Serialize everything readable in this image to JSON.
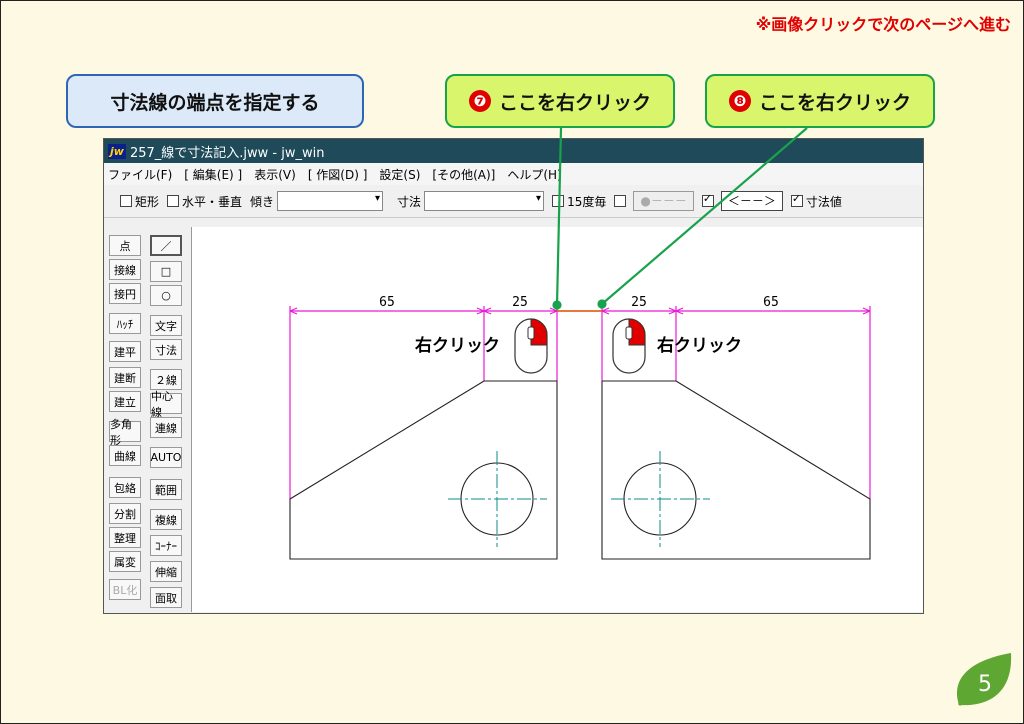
{
  "notice": "※画像クリックで次のページへ進む",
  "callouts": {
    "main": "寸法線の端点を指定する",
    "step7_num": "❼",
    "step7_text": "ここを右クリック",
    "step8_num": "❽",
    "step8_text": "ここを右クリック"
  },
  "window": {
    "logo": "jw",
    "title": "257_線で寸法記入.jww - jw_win"
  },
  "menu": [
    "ファイル(F)",
    "[ 編集(E) ]",
    "表示(V)",
    "[ 作図(D) ]",
    "設定(S)",
    "[その他(A)]",
    "ヘルプ(H)"
  ],
  "toolbar": {
    "rect": "矩形",
    "hv": "水平・垂直",
    "tilt": "傾き",
    "dim": "寸法",
    "deg15": "15度毎",
    "dot_btn": "●－－－",
    "arrow_btn": "＜－－＞",
    "dim_value": "寸法値"
  },
  "tools_col1": [
    "点",
    "接線",
    "接円",
    "ﾊｯﾁ",
    "建平",
    "建断",
    "建立",
    "多角形",
    "曲線",
    "包絡",
    "分割",
    "整理",
    "属変",
    "BL化"
  ],
  "tools_col2": [
    "／",
    "□",
    "○",
    "文字",
    "寸法",
    "２線",
    "中心線",
    "連線",
    "AUTO",
    "範囲",
    "複線",
    "ｺｰﾅｰ",
    "伸縮",
    "面取"
  ],
  "drawing": {
    "dim_65_left": "65",
    "dim_25_left": "25",
    "dim_25_right": "25",
    "dim_65_right": "65",
    "right_click_label": "右クリック"
  },
  "colors": {
    "dimension": "#e81bd6",
    "centerline": "#0a8c8c",
    "accent_red": "#e00000",
    "leaf": "#5fa733"
  },
  "page_number": "5"
}
